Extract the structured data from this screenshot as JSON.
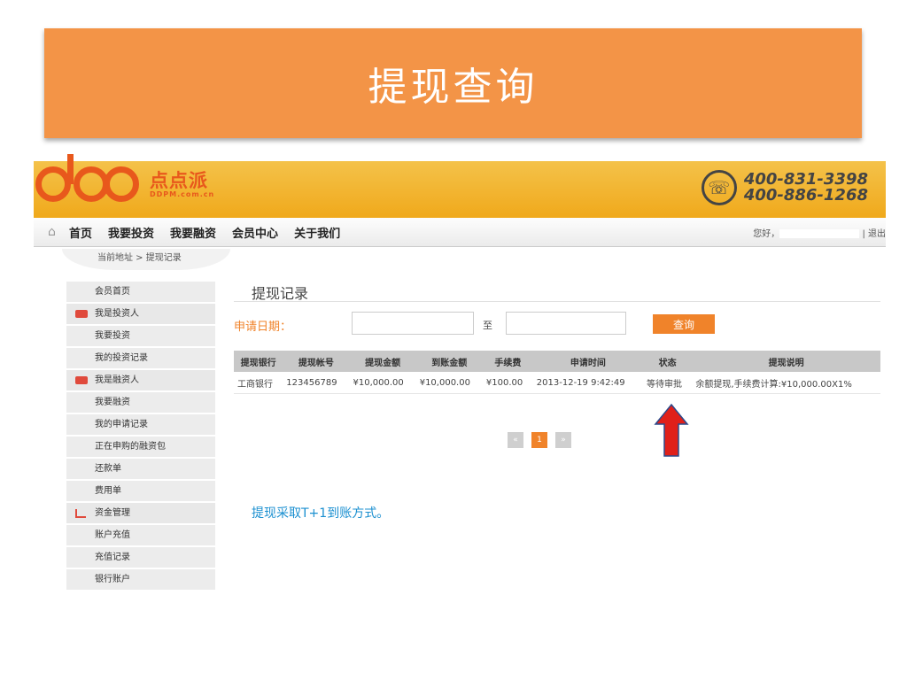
{
  "banner": {
    "title": "提现查询"
  },
  "site": {
    "logo_cn": "点点派",
    "logo_en": "DDPM.com.cn",
    "phones": [
      "400-831-3398",
      "400-886-1268"
    ]
  },
  "nav": {
    "items": [
      "首页",
      "我要投资",
      "我要融资",
      "会员中心",
      "关于我们"
    ],
    "greeting": "您好，",
    "logout": "| 退出"
  },
  "breadcrumb": "当前地址 > 提现记录",
  "sidebar": {
    "items": [
      {
        "label": "会员首页",
        "group": false
      },
      {
        "label": "我是投资人",
        "group": true,
        "icon": "red"
      },
      {
        "label": "我要投资",
        "group": false
      },
      {
        "label": "我的投资记录",
        "group": false
      },
      {
        "label": "我是融资人",
        "group": true,
        "icon": "red"
      },
      {
        "label": "我要融资",
        "group": false
      },
      {
        "label": "我的申请记录",
        "group": false
      },
      {
        "label": "正在申购的融资包",
        "group": false
      },
      {
        "label": "还款单",
        "group": false
      },
      {
        "label": "费用单",
        "group": false
      },
      {
        "label": "资金管理",
        "group": true,
        "icon": "chart"
      },
      {
        "label": "账户充值",
        "group": false
      },
      {
        "label": "充值记录",
        "group": false
      },
      {
        "label": "银行账户",
        "group": false
      }
    ]
  },
  "panel": {
    "title": "提现记录",
    "filter_label": "申请日期：",
    "to_label": "至",
    "query_label": "查询"
  },
  "table": {
    "headers": [
      "提现银行",
      "提现帐号",
      "提现金额",
      "到账金额",
      "手续费",
      "申请时间",
      "状态",
      "提现说明"
    ],
    "rows": [
      [
        "工商银行",
        "123456789",
        "¥10,000.00",
        "¥10,000.00",
        "¥100.00",
        "2013-12-19 9:42:49",
        "等待审批",
        "余额提现,手续费计算:¥10,000.00X1%"
      ]
    ]
  },
  "pager": {
    "prev": "«",
    "current": "1",
    "next": "»"
  },
  "note": "提现采取T+1到账方式。",
  "colors": {
    "banner": "#f39447",
    "accent": "#f0832a",
    "arrow": "#e0201a",
    "note": "#1a8fd0"
  }
}
